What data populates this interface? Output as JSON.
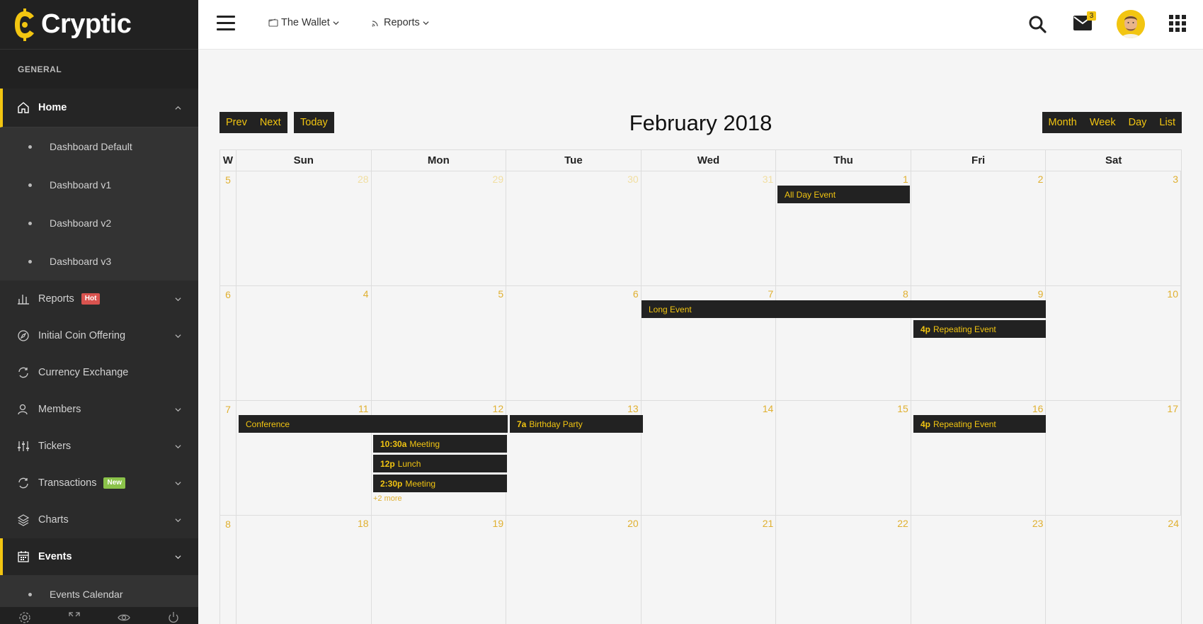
{
  "brand": {
    "name": "Cryptic"
  },
  "sidebar": {
    "section": "GENERAL",
    "home": {
      "label": "Home",
      "icon": "home-icon"
    },
    "home_sub": [
      "Dashboard Default",
      "Dashboard v1",
      "Dashboard v2",
      "Dashboard v3"
    ],
    "items": [
      {
        "label": "Reports",
        "icon": "bar-chart-icon",
        "badge": "Hot"
      },
      {
        "label": "Initial Coin Offering",
        "icon": "compass-icon"
      },
      {
        "label": "Currency Exchange",
        "icon": "refresh-icon"
      },
      {
        "label": "Members",
        "icon": "user-icon"
      },
      {
        "label": "Tickers",
        "icon": "sliders-icon"
      },
      {
        "label": "Transactions",
        "icon": "refresh-icon",
        "badge": "New"
      },
      {
        "label": "Charts",
        "icon": "layers-icon"
      }
    ],
    "events": {
      "label": "Events",
      "icon": "calendar-icon"
    },
    "events_sub": [
      "Events Calendar"
    ]
  },
  "topbar": {
    "wallet": "The Wallet",
    "reports": "Reports",
    "mail_count": "3"
  },
  "calendar": {
    "title": "February 2018",
    "buttons": {
      "prev": "Prev",
      "next": "Next",
      "today": "Today",
      "month": "Month",
      "week": "Week",
      "day": "Day",
      "list": "List"
    },
    "week_header": "W",
    "weekdays": [
      "Sun",
      "Mon",
      "Tue",
      "Wed",
      "Thu",
      "Fri",
      "Sat"
    ],
    "weeks": [
      {
        "wk": "5",
        "days": [
          "28",
          "29",
          "30",
          "31",
          "1",
          "2",
          "3"
        ]
      },
      {
        "wk": "6",
        "days": [
          "4",
          "5",
          "6",
          "7",
          "8",
          "9",
          "10"
        ]
      },
      {
        "wk": "7",
        "days": [
          "11",
          "12",
          "13",
          "14",
          "15",
          "16",
          "17"
        ]
      },
      {
        "wk": "8",
        "days": [
          "18",
          "19",
          "20",
          "21",
          "22",
          "23",
          "24"
        ]
      }
    ],
    "events": {
      "all_day": "All Day Event",
      "long": "Long Event",
      "repeat1_time": "4p",
      "repeat1_title": "Repeating Event",
      "conference": "Conference",
      "birthday_time": "7a",
      "birthday_title": "Birthday Party",
      "meeting1_time": "10:30a",
      "meeting1_title": "Meeting",
      "lunch_time": "12p",
      "lunch_title": "Lunch",
      "meeting2_time": "2:30p",
      "meeting2_title": "Meeting",
      "more": "+2 more",
      "repeat2_time": "4p",
      "repeat2_title": "Repeating Event"
    }
  },
  "colors": {
    "accent": "#f2c511",
    "sidebar": "#2b2b2b",
    "event_bg": "#222222",
    "hot": "#d9534f",
    "new": "#8bc34a"
  }
}
